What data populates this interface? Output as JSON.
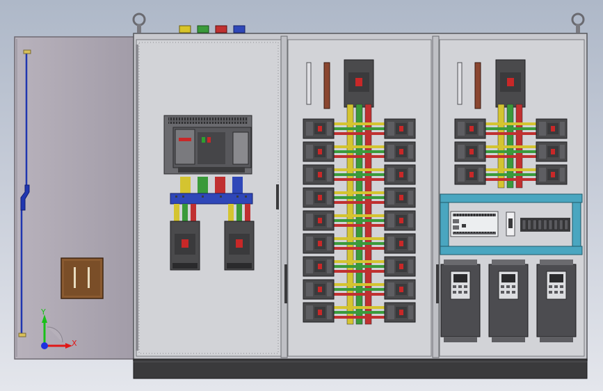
{
  "colors": {
    "background_top": "#aeb8c8",
    "background_bottom": "#e4e6ec",
    "cabinet": "#c9cacf",
    "plinth": "#3a3a3c",
    "door": "#a9a5ae",
    "breaker": "#4a4a4c",
    "busbar_yellow": "#d4c430",
    "busbar_green": "#3a9a3a",
    "busbar_red": "#c03030",
    "busbar_blue": "#2f47b8",
    "din_rail_frame": "#4aa6c0",
    "axis_red": "#e01818",
    "axis_green": "#18c018",
    "axis_blue": "#1e30e0"
  },
  "icons": {
    "lifting_eye": "lifting-eye-icon",
    "triad": "coordinate-triad-icon",
    "door_lock": "door-lock-icon"
  },
  "triad": {
    "x_label": "X",
    "y_label": "Y"
  }
}
